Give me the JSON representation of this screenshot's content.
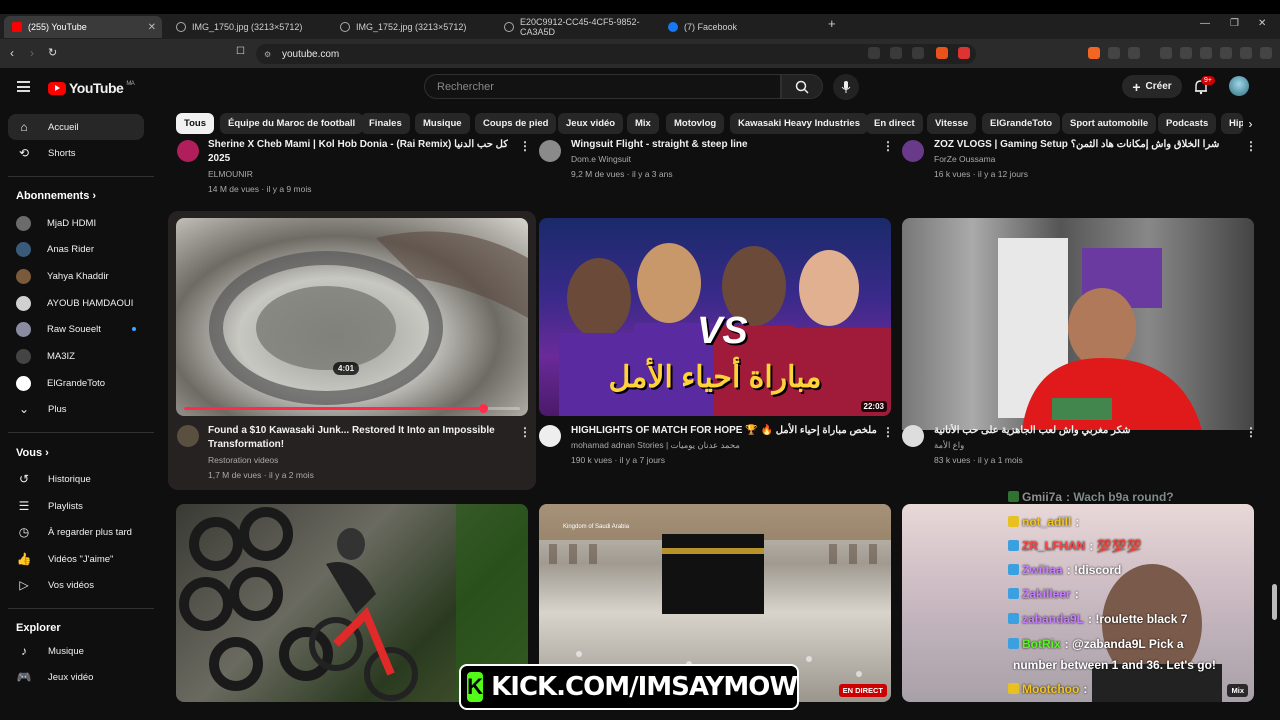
{
  "browser": {
    "tabs": [
      {
        "label": "(255) YouTube",
        "active": true
      },
      {
        "label": "IMG_1750.jpg (3213×5712)",
        "active": false
      },
      {
        "label": "IMG_1752.jpg (3213×5712)",
        "active": false
      },
      {
        "label": "E20C9912-CC45-4CF5-9852-CA3A5D",
        "active": false
      },
      {
        "label": "(7) Facebook",
        "active": false
      }
    ],
    "url": "youtube.com"
  },
  "masthead": {
    "logo_text": "YouTube",
    "country": "MA",
    "search_placeholder": "Rechercher",
    "create_label": "Créer",
    "notif_badge": "9+"
  },
  "sidebar": {
    "main": [
      {
        "label": "Accueil",
        "icon": "home-icon",
        "active": true
      },
      {
        "label": "Shorts",
        "icon": "shorts-icon",
        "active": false
      }
    ],
    "subs_heading": "Abonnements",
    "subs": [
      {
        "label": "MjaD HDMI",
        "color": "#6b6b6b"
      },
      {
        "label": "Anas Rider",
        "color": "#3a5a7a"
      },
      {
        "label": "Yahya Khaddir",
        "color": "#7a5a3a"
      },
      {
        "label": "AYOUB HAMDAOUI",
        "color": "#d0d0d0"
      },
      {
        "label": "Raw Soueelt",
        "color": "#8a8aa0",
        "live": true
      },
      {
        "label": "MA3IZ",
        "color": "#444"
      },
      {
        "label": "ElGrandeToto",
        "color": "#ffffff"
      },
      {
        "label": "Plus",
        "color": ""
      }
    ],
    "you_heading": "Vous",
    "you": [
      {
        "label": "Historique",
        "icon": "history-icon"
      },
      {
        "label": "Playlists",
        "icon": "playlists-icon"
      },
      {
        "label": "À regarder plus tard",
        "icon": "watch-later-icon"
      },
      {
        "label": "Vidéos \"J'aime\"",
        "icon": "liked-icon"
      },
      {
        "label": "Vos vidéos",
        "icon": "your-videos-icon"
      }
    ],
    "explore_heading": "Explorer",
    "explore": [
      {
        "label": "Musique",
        "icon": "music-icon"
      },
      {
        "label": "Jeux vidéo",
        "icon": "gaming-icon"
      }
    ]
  },
  "chips": [
    "Tous",
    "Équipe du Maroc de football",
    "Finales",
    "Musique",
    "Coups de pied",
    "Jeux vidéo",
    "Mix",
    "Motovlog",
    "Kawasaki Heavy Industries",
    "En direct",
    "Vitesse",
    "ElGrandeToto",
    "Sport automobile",
    "Podcasts",
    "Hip"
  ],
  "videos_top": [
    {
      "title1": "Sherine X Cheb Mami | Kol Hob Donia - (Rai Remix) كل حب الدنيا",
      "title2": "2025",
      "channel": "ELMOUNIR",
      "meta": "14 M de vues · il y a 9 mois"
    },
    {
      "title1": "Wingsuit Flight - straight & steep line",
      "title2": "",
      "channel": "Dom.e Wingsuit",
      "meta": "9,2 M de vues · il y a 3 ans"
    },
    {
      "title1": "ZOZ VLOGS | Gaming Setup شرا الخلاق واش إمكانات هاد الثمن؟ 😅",
      "title2": "",
      "channel": "ForZe Oussama",
      "meta": "16 k vues · il y a 12 jours"
    }
  ],
  "videos_mid": [
    {
      "title1": "Found a $10 Kawasaki Junk... Restored It Into an Impossible",
      "title2": "Transformation!",
      "channel": "Restoration videos",
      "meta": "1,7 M de vues · il y a 2 mois",
      "duration": "4:01",
      "progress": 0.89
    },
    {
      "title1": "HIGHLIGHTS OF MATCH FOR HOPE 🏆 🔥 ملخص مباراة إحياء الأمل",
      "title2": "",
      "channel": "mohamad adnan Stories | محمد عدنان يوميات",
      "meta": "190 k vues · il y a 7 jours",
      "duration": "22:03",
      "overlay_text": "مباراة أحياء الأمل",
      "vs_text": "VS"
    },
    {
      "title1": "شكر مغربي واش لعب الجاهزية على حب الأنانية",
      "title2": "",
      "channel": "واع الأمة",
      "meta": "83 k vues · il y a 1 mois"
    }
  ],
  "videos_bottom": [
    {
      "badge": ""
    },
    {
      "badge": "EN DIRECT",
      "caption": "Kingdom of Saudi Arabia"
    },
    {
      "badge": "Mix"
    }
  ],
  "overlay": {
    "kick_text": "KICK.COM/IMSAYMOW",
    "kick_logo": "K",
    "chat": [
      {
        "user": "Gmii7a",
        "msg": "Wach b9a round?",
        "color": "#b0b0b0"
      },
      {
        "user": "not_adill",
        "msg": "",
        "color": "#f5c518"
      },
      {
        "user": "ZR_LFHAN",
        "msg": "💯💯💯",
        "color": "#ff4444"
      },
      {
        "user": "Zwiitaa",
        "msg": "!discord",
        "color": "#c77dff"
      },
      {
        "user": "Zakilleer",
        "msg": "",
        "color": "#c77dff"
      },
      {
        "user": "zabanda9L",
        "msg": "!roulette black 7",
        "color": "#c77dff"
      },
      {
        "user": "BotRix",
        "msg": "@zabanda9L Pick a",
        "color": "#53fc18"
      },
      {
        "user": "",
        "msg": "number between 1 and 36. Let's go!",
        "color": "#fff"
      },
      {
        "user": "Mootchoo",
        "msg": "",
        "color": "#f5c518"
      }
    ]
  }
}
